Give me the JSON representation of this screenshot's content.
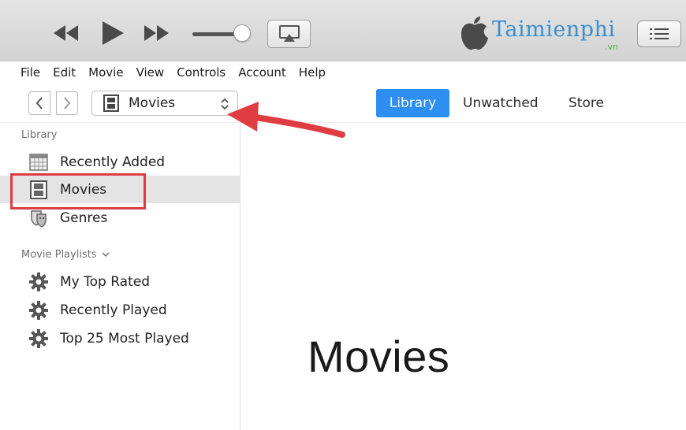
{
  "brand": {
    "logo_text": "Taimienphi",
    "logo_suffix": ".vn",
    "logo_color": "#3b8fd0"
  },
  "player": {
    "rewind_icon": "rewind-icon",
    "play_icon": "play-icon",
    "forward_icon": "fast-forward-icon",
    "airplay_icon": "airplay-icon",
    "up_next_icon": "list-icon"
  },
  "menubar": {
    "items": [
      "File",
      "Edit",
      "Movie",
      "View",
      "Controls",
      "Account",
      "Help"
    ]
  },
  "nav": {
    "back_icon": "chevron-left-icon",
    "forward_icon": "chevron-right-icon",
    "media_kind": "Movies",
    "tabs": [
      {
        "label": "Library",
        "active": true
      },
      {
        "label": "Unwatched",
        "active": false
      },
      {
        "label": "Store",
        "active": false
      }
    ],
    "accent": "#2d8ff2"
  },
  "sidebar": {
    "library_heading": "Library",
    "library_items": [
      {
        "label": "Recently Added",
        "icon": "calendar-grid-icon"
      },
      {
        "label": "Movies",
        "icon": "film-icon",
        "selected": true
      },
      {
        "label": "Genres",
        "icon": "theater-masks-icon"
      }
    ],
    "playlists_heading": "Movie Playlists",
    "playlist_items": [
      {
        "label": "My Top Rated",
        "icon": "smart-playlist-gear-icon"
      },
      {
        "label": "Recently Played",
        "icon": "smart-playlist-gear-icon"
      },
      {
        "label": "Top 25 Most Played",
        "icon": "smart-playlist-gear-icon"
      }
    ]
  },
  "main": {
    "title": "Movies"
  },
  "annotation": {
    "highlight_color": "#de3b46"
  }
}
